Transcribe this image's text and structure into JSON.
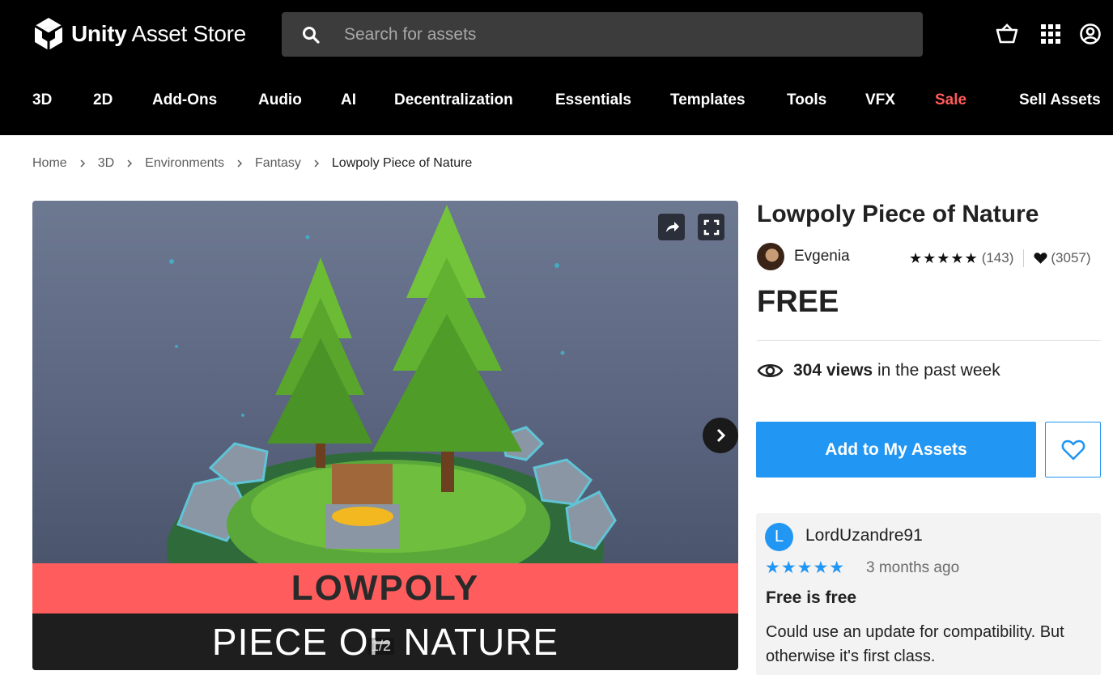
{
  "header": {
    "logo_brand": "Unity",
    "logo_product": "Asset Store",
    "search_placeholder": "Search for assets",
    "icons": [
      "search-icon",
      "cart-icon",
      "apps-grid-icon",
      "account-icon"
    ]
  },
  "nav": {
    "items": [
      "3D",
      "2D",
      "Add-Ons",
      "Audio",
      "AI",
      "Decentralization",
      "Essentials",
      "Templates",
      "Tools",
      "VFX",
      "Sale",
      "Sell Assets"
    ],
    "sale_color": "#ff5a5a"
  },
  "breadcrumb": [
    "Home",
    "3D",
    "Environments",
    "Fantasy",
    "Lowpoly Piece of Nature"
  ],
  "viewer": {
    "banner_line1": "LOWPOLY",
    "banner_line2": "PIECE OF NATURE",
    "counter": "1/2",
    "banner_color": "#ff5d5d"
  },
  "product": {
    "title": "Lowpoly Piece of Nature",
    "publisher": "Evgenia",
    "stars": "★★★★★",
    "rating_count": "(143)",
    "favorites_count": "(3057)",
    "price": "FREE",
    "views_count": "304 views",
    "views_suffix": "in the past week",
    "add_button": "Add to My Assets",
    "accent_color": "#2196f3"
  },
  "review": {
    "avatar_letter": "L",
    "user": "LordUzandre91",
    "stars": "★★★★★",
    "date": "3 months ago",
    "title": "Free is free",
    "text": "Could use an update for compatibility. But otherwise it's first class."
  }
}
